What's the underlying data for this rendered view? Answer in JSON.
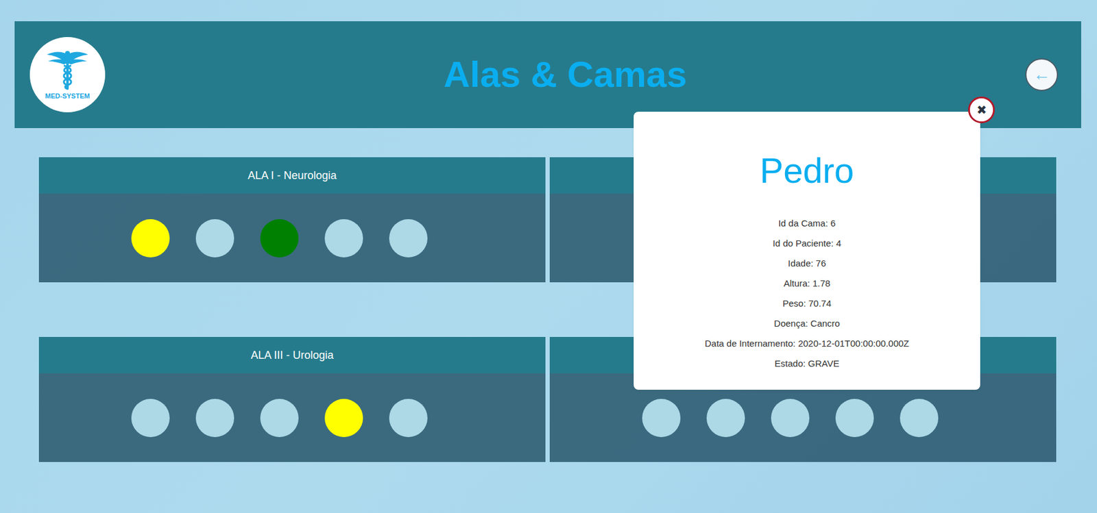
{
  "header": {
    "logo_text": "MED-SYSTEM",
    "title": "Alas & Camas",
    "back_button": "←"
  },
  "wards": [
    {
      "title": "ALA I - Neurologia",
      "beds": [
        {
          "color": "#ffff00"
        },
        {
          "color": "#add8e6"
        },
        {
          "color": "#008000"
        },
        {
          "color": "#add8e6"
        },
        {
          "color": "#add8e6"
        }
      ]
    },
    {
      "beds": []
    },
    {
      "title": "ALA III - Urologia",
      "beds": [
        {
          "color": "#add8e6"
        },
        {
          "color": "#add8e6"
        },
        {
          "color": "#add8e6"
        },
        {
          "color": "#ffff00"
        },
        {
          "color": "#add8e6"
        }
      ]
    },
    {
      "beds": [
        {
          "color": "#add8e6"
        },
        {
          "color": "#add8e6"
        },
        {
          "color": "#add8e6"
        },
        {
          "color": "#add8e6"
        },
        {
          "color": "#add8e6"
        }
      ]
    }
  ],
  "modal": {
    "close_button": "✖",
    "name": "Pedro",
    "details": [
      "Id da Cama: 6",
      "Id do Paciente: 4",
      "Idade: 76",
      "Altura: 1.78",
      "Peso: 70.74",
      "Doença: Cancro",
      "Data de Internamento: 2020-12-01T00:00:00.000Z",
      "Estado: GRAVE"
    ]
  }
}
